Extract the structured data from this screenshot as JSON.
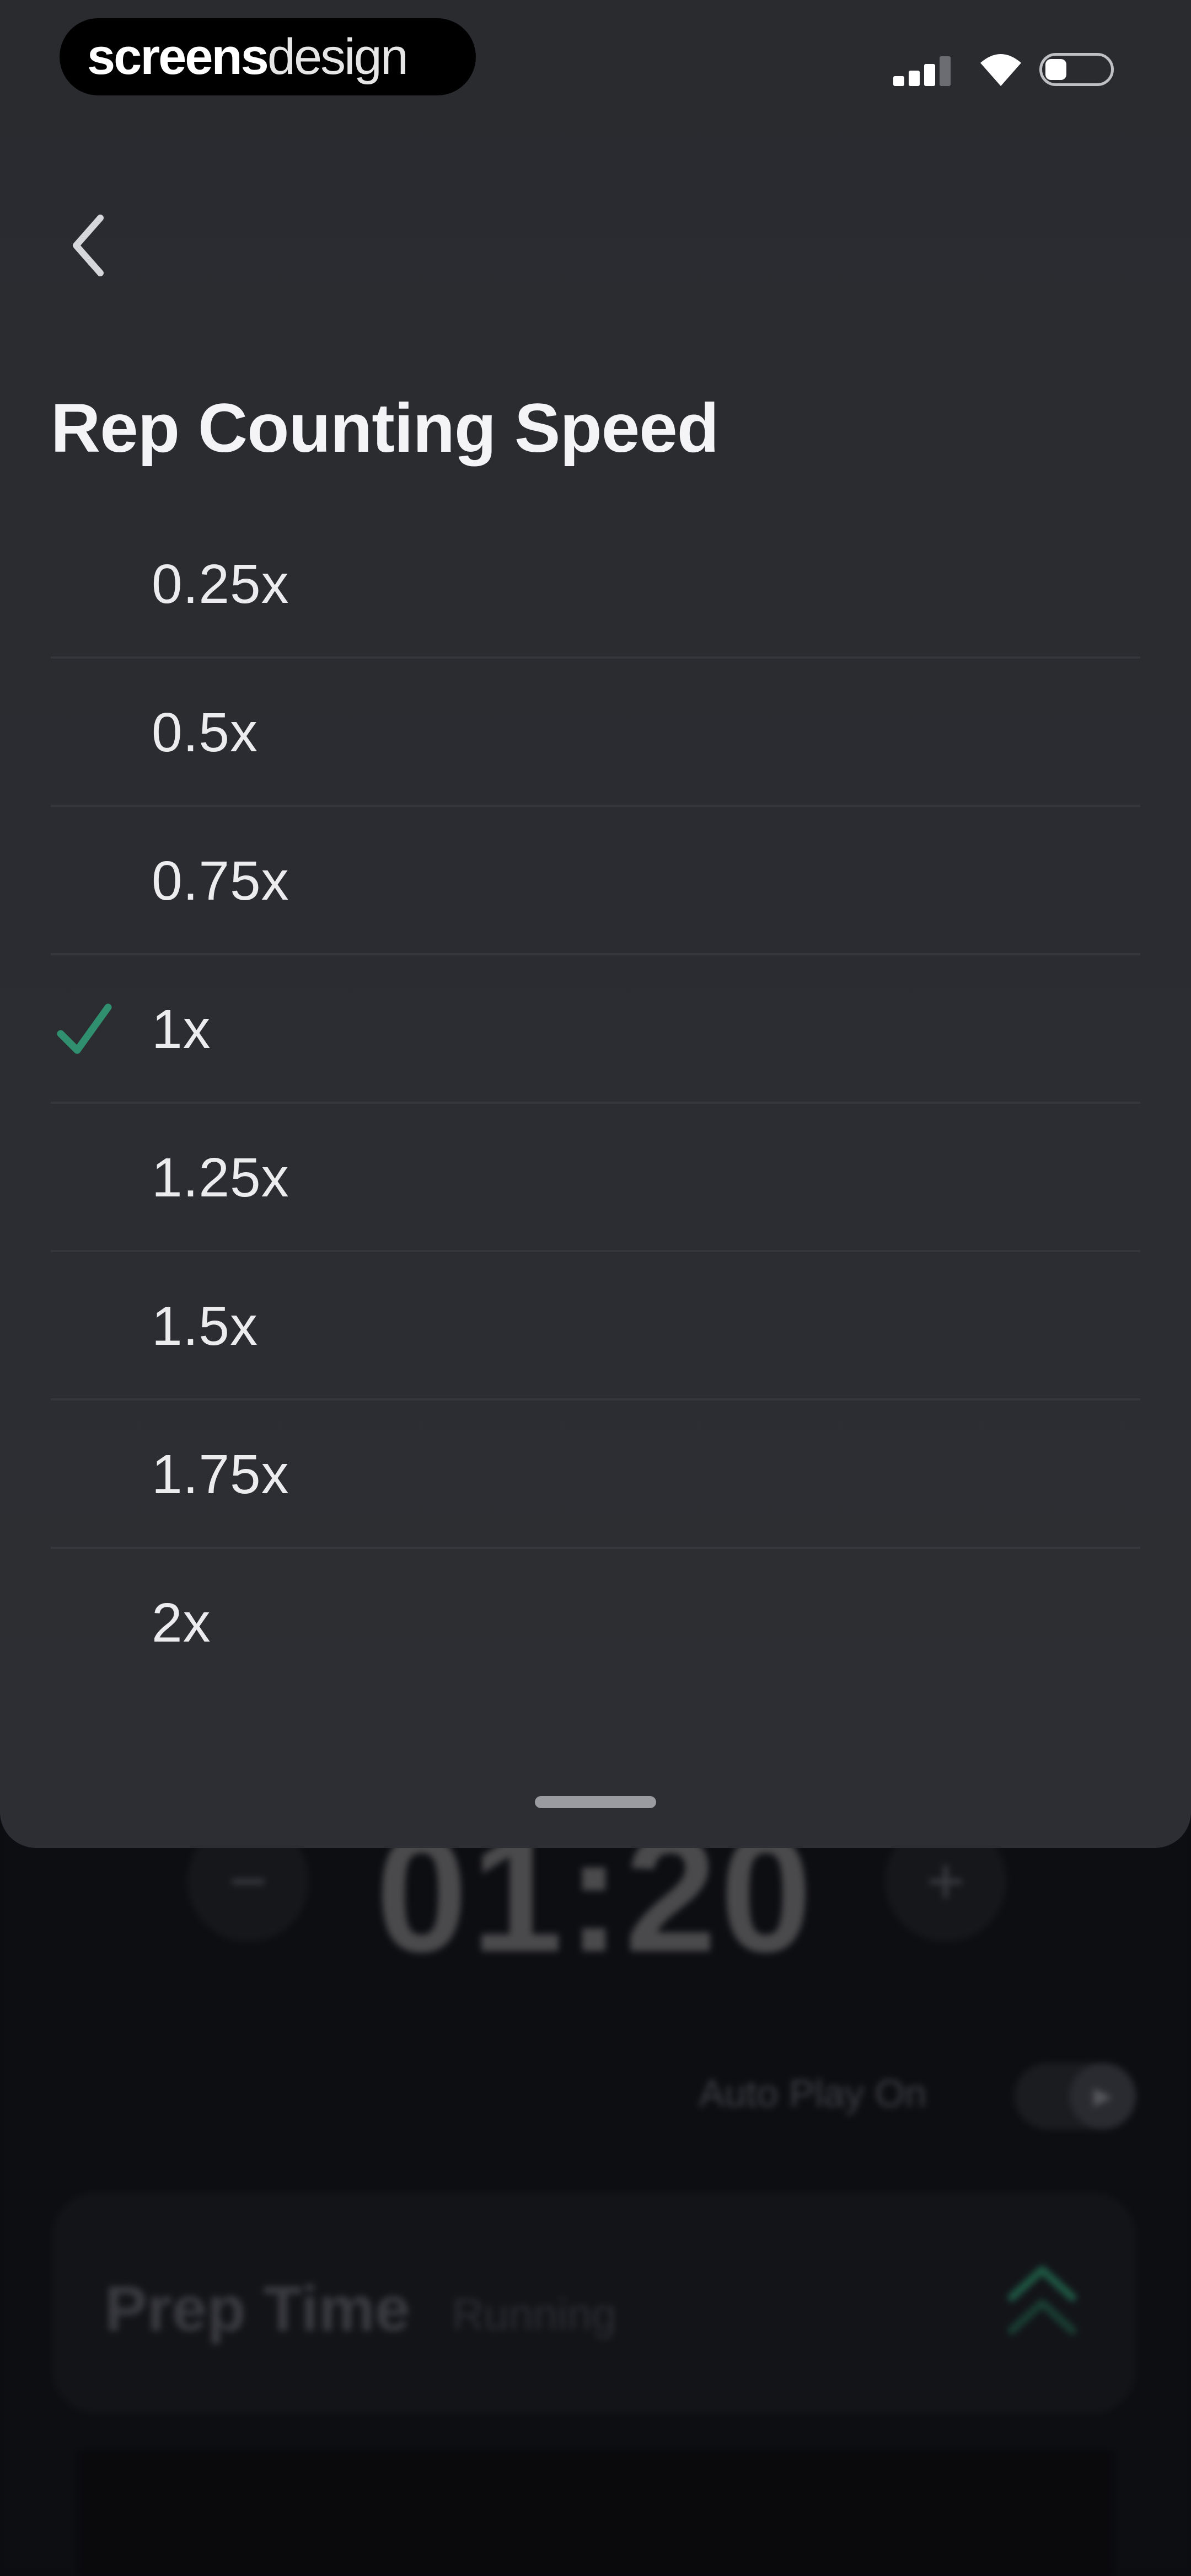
{
  "background": {
    "timer": "01:20",
    "minus_symbol": "−",
    "plus_symbol": "+",
    "autoplay_label": "Auto Play On",
    "card_title": "Prep Time",
    "card_status": "Running"
  },
  "status_bar": {
    "brand_bold": "screens",
    "brand_light": "design"
  },
  "sheet": {
    "title": "Rep Counting Speed",
    "selected_index": 3,
    "options": [
      {
        "label": "0.25x"
      },
      {
        "label": "0.5x"
      },
      {
        "label": "0.75x"
      },
      {
        "label": "1x"
      },
      {
        "label": "1.25x"
      },
      {
        "label": "1.5x"
      },
      {
        "label": "1.75x"
      },
      {
        "label": "2x"
      }
    ]
  },
  "icons": {
    "back": "chevron-left-icon",
    "check": "check-icon",
    "play": "play-icon",
    "expand": "chevron-up-double-icon"
  },
  "colors": {
    "accent": "#2f8f6e",
    "sheet": "#2a2b2f"
  }
}
